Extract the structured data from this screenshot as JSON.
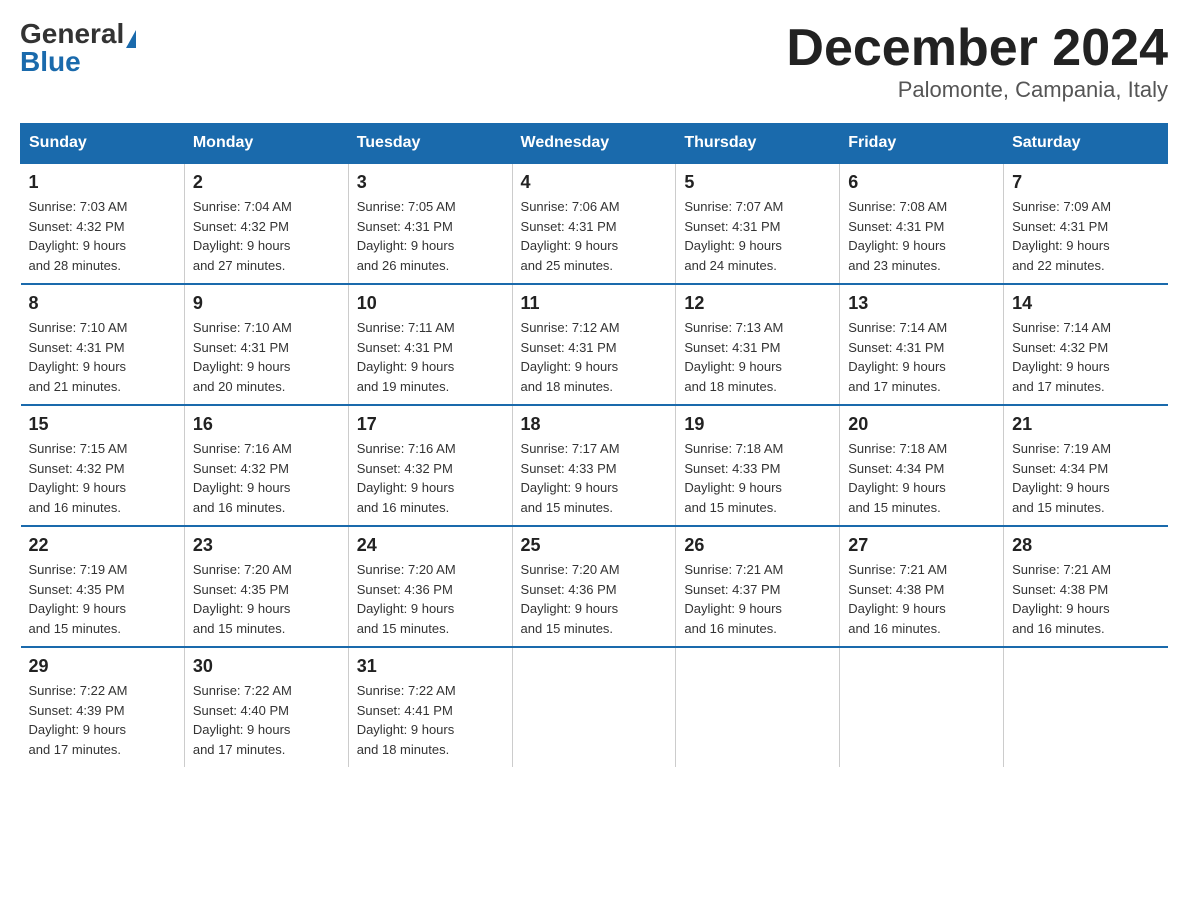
{
  "header": {
    "logo_general": "General",
    "logo_blue": "Blue",
    "title": "December 2024",
    "subtitle": "Palomonte, Campania, Italy"
  },
  "days_of_week": [
    "Sunday",
    "Monday",
    "Tuesday",
    "Wednesday",
    "Thursday",
    "Friday",
    "Saturday"
  ],
  "weeks": [
    [
      {
        "day": "1",
        "sunrise": "7:03 AM",
        "sunset": "4:32 PM",
        "daylight": "9 hours and 28 minutes."
      },
      {
        "day": "2",
        "sunrise": "7:04 AM",
        "sunset": "4:32 PM",
        "daylight": "9 hours and 27 minutes."
      },
      {
        "day": "3",
        "sunrise": "7:05 AM",
        "sunset": "4:31 PM",
        "daylight": "9 hours and 26 minutes."
      },
      {
        "day": "4",
        "sunrise": "7:06 AM",
        "sunset": "4:31 PM",
        "daylight": "9 hours and 25 minutes."
      },
      {
        "day": "5",
        "sunrise": "7:07 AM",
        "sunset": "4:31 PM",
        "daylight": "9 hours and 24 minutes."
      },
      {
        "day": "6",
        "sunrise": "7:08 AM",
        "sunset": "4:31 PM",
        "daylight": "9 hours and 23 minutes."
      },
      {
        "day": "7",
        "sunrise": "7:09 AM",
        "sunset": "4:31 PM",
        "daylight": "9 hours and 22 minutes."
      }
    ],
    [
      {
        "day": "8",
        "sunrise": "7:10 AM",
        "sunset": "4:31 PM",
        "daylight": "9 hours and 21 minutes."
      },
      {
        "day": "9",
        "sunrise": "7:10 AM",
        "sunset": "4:31 PM",
        "daylight": "9 hours and 20 minutes."
      },
      {
        "day": "10",
        "sunrise": "7:11 AM",
        "sunset": "4:31 PM",
        "daylight": "9 hours and 19 minutes."
      },
      {
        "day": "11",
        "sunrise": "7:12 AM",
        "sunset": "4:31 PM",
        "daylight": "9 hours and 18 minutes."
      },
      {
        "day": "12",
        "sunrise": "7:13 AM",
        "sunset": "4:31 PM",
        "daylight": "9 hours and 18 minutes."
      },
      {
        "day": "13",
        "sunrise": "7:14 AM",
        "sunset": "4:31 PM",
        "daylight": "9 hours and 17 minutes."
      },
      {
        "day": "14",
        "sunrise": "7:14 AM",
        "sunset": "4:32 PM",
        "daylight": "9 hours and 17 minutes."
      }
    ],
    [
      {
        "day": "15",
        "sunrise": "7:15 AM",
        "sunset": "4:32 PM",
        "daylight": "9 hours and 16 minutes."
      },
      {
        "day": "16",
        "sunrise": "7:16 AM",
        "sunset": "4:32 PM",
        "daylight": "9 hours and 16 minutes."
      },
      {
        "day": "17",
        "sunrise": "7:16 AM",
        "sunset": "4:32 PM",
        "daylight": "9 hours and 16 minutes."
      },
      {
        "day": "18",
        "sunrise": "7:17 AM",
        "sunset": "4:33 PM",
        "daylight": "9 hours and 15 minutes."
      },
      {
        "day": "19",
        "sunrise": "7:18 AM",
        "sunset": "4:33 PM",
        "daylight": "9 hours and 15 minutes."
      },
      {
        "day": "20",
        "sunrise": "7:18 AM",
        "sunset": "4:34 PM",
        "daylight": "9 hours and 15 minutes."
      },
      {
        "day": "21",
        "sunrise": "7:19 AM",
        "sunset": "4:34 PM",
        "daylight": "9 hours and 15 minutes."
      }
    ],
    [
      {
        "day": "22",
        "sunrise": "7:19 AM",
        "sunset": "4:35 PM",
        "daylight": "9 hours and 15 minutes."
      },
      {
        "day": "23",
        "sunrise": "7:20 AM",
        "sunset": "4:35 PM",
        "daylight": "9 hours and 15 minutes."
      },
      {
        "day": "24",
        "sunrise": "7:20 AM",
        "sunset": "4:36 PM",
        "daylight": "9 hours and 15 minutes."
      },
      {
        "day": "25",
        "sunrise": "7:20 AM",
        "sunset": "4:36 PM",
        "daylight": "9 hours and 15 minutes."
      },
      {
        "day": "26",
        "sunrise": "7:21 AM",
        "sunset": "4:37 PM",
        "daylight": "9 hours and 16 minutes."
      },
      {
        "day": "27",
        "sunrise": "7:21 AM",
        "sunset": "4:38 PM",
        "daylight": "9 hours and 16 minutes."
      },
      {
        "day": "28",
        "sunrise": "7:21 AM",
        "sunset": "4:38 PM",
        "daylight": "9 hours and 16 minutes."
      }
    ],
    [
      {
        "day": "29",
        "sunrise": "7:22 AM",
        "sunset": "4:39 PM",
        "daylight": "9 hours and 17 minutes."
      },
      {
        "day": "30",
        "sunrise": "7:22 AM",
        "sunset": "4:40 PM",
        "daylight": "9 hours and 17 minutes."
      },
      {
        "day": "31",
        "sunrise": "7:22 AM",
        "sunset": "4:41 PM",
        "daylight": "9 hours and 18 minutes."
      },
      null,
      null,
      null,
      null
    ]
  ],
  "labels": {
    "sunrise": "Sunrise:",
    "sunset": "Sunset:",
    "daylight": "Daylight:"
  }
}
